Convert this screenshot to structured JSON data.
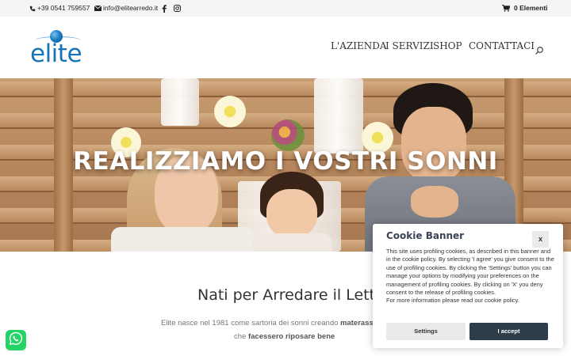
{
  "topbar": {
    "phone": "+39 0541 759557",
    "email": "info@elitearredo.it",
    "social": [
      "facebook-icon",
      "instagram-icon"
    ],
    "cart_label": "0 Elementi"
  },
  "header": {
    "logo_text": "elite",
    "nav": [
      "L'AZIENDA",
      "I SERVIZI",
      "SHOP",
      "CONTATTACI"
    ]
  },
  "hero": {
    "title": "REALIZZIAMO I VOSTRI SONNI"
  },
  "content": {
    "title": "Nati per Arredare il Letto",
    "line1_prefix": "Elite nasce nel 1981 come sartoria dei sonni creando ",
    "line1_bold": "materass",
    "line2_prefix": "che ",
    "line2_bold": "facessero riposare bene"
  },
  "cookie": {
    "title": "Cookie Banner",
    "close": "x",
    "text": "This site uses profiling cookies, as described in this banner and in the cookie policy. By selecting 'I agree' you give consent to the use of profiling cookies. By clicking the 'Settings' button you can manage your options by modifying your preferences on the management of profiling cookies. By clicking on 'X' you deny consent to the release of profiling cookies.",
    "text2": "For more information please read our cookie policy.",
    "settings_label": "Settings",
    "accept_label": "I accept"
  },
  "colors": {
    "brand": "#1774b9",
    "whatsapp": "#25d366",
    "accept_button": "#2f3d4a"
  }
}
